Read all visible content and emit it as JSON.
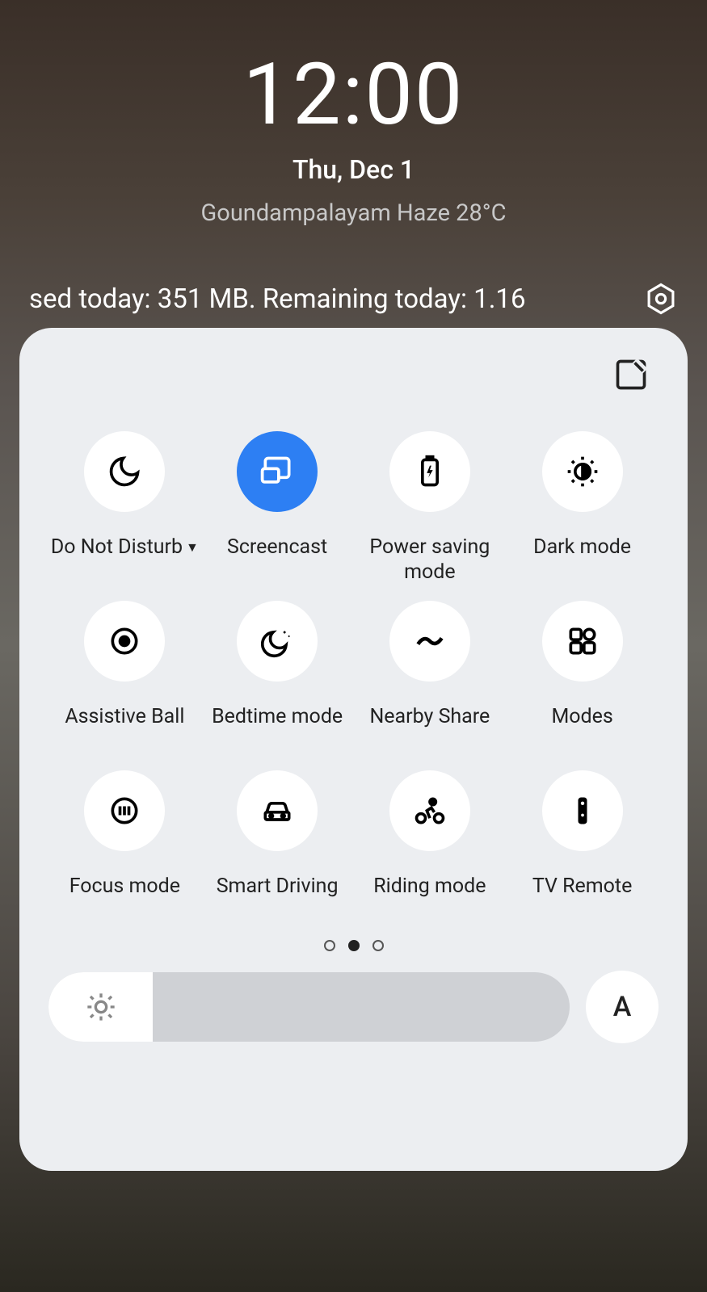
{
  "header": {
    "time": "12:00",
    "date": "Thu, Dec 1",
    "weather": "Goundampalayam Haze 28°C"
  },
  "data_usage": "sed today: 351 MB. Remaining today: 1.16",
  "tiles": [
    {
      "label": "Do Not Disturb",
      "icon": "moon",
      "active": false,
      "dropdown": true
    },
    {
      "label": "Screencast",
      "icon": "screencast",
      "active": true,
      "dropdown": false
    },
    {
      "label": "Power saving mode",
      "icon": "battery",
      "active": false,
      "dropdown": false
    },
    {
      "label": "Dark mode",
      "icon": "darkmode",
      "active": false,
      "dropdown": false
    },
    {
      "label": "Assistive Ball",
      "icon": "target",
      "active": false,
      "dropdown": false
    },
    {
      "label": "Bedtime mode",
      "icon": "moonstars",
      "active": false,
      "dropdown": false
    },
    {
      "label": "Nearby Share",
      "icon": "nearby",
      "active": false,
      "dropdown": false
    },
    {
      "label": "Modes",
      "icon": "grid",
      "active": false,
      "dropdown": false
    },
    {
      "label": "Focus mode",
      "icon": "focus",
      "active": false,
      "dropdown": false
    },
    {
      "label": "Smart Driving",
      "icon": "car",
      "active": false,
      "dropdown": false
    },
    {
      "label": "Riding mode",
      "icon": "bike",
      "active": false,
      "dropdown": false
    },
    {
      "label": "TV Remote",
      "icon": "remote",
      "active": false,
      "dropdown": false
    }
  ],
  "pagination": {
    "total": 3,
    "active": 1
  },
  "brightness": {
    "percent": 20,
    "auto_label": "A"
  }
}
